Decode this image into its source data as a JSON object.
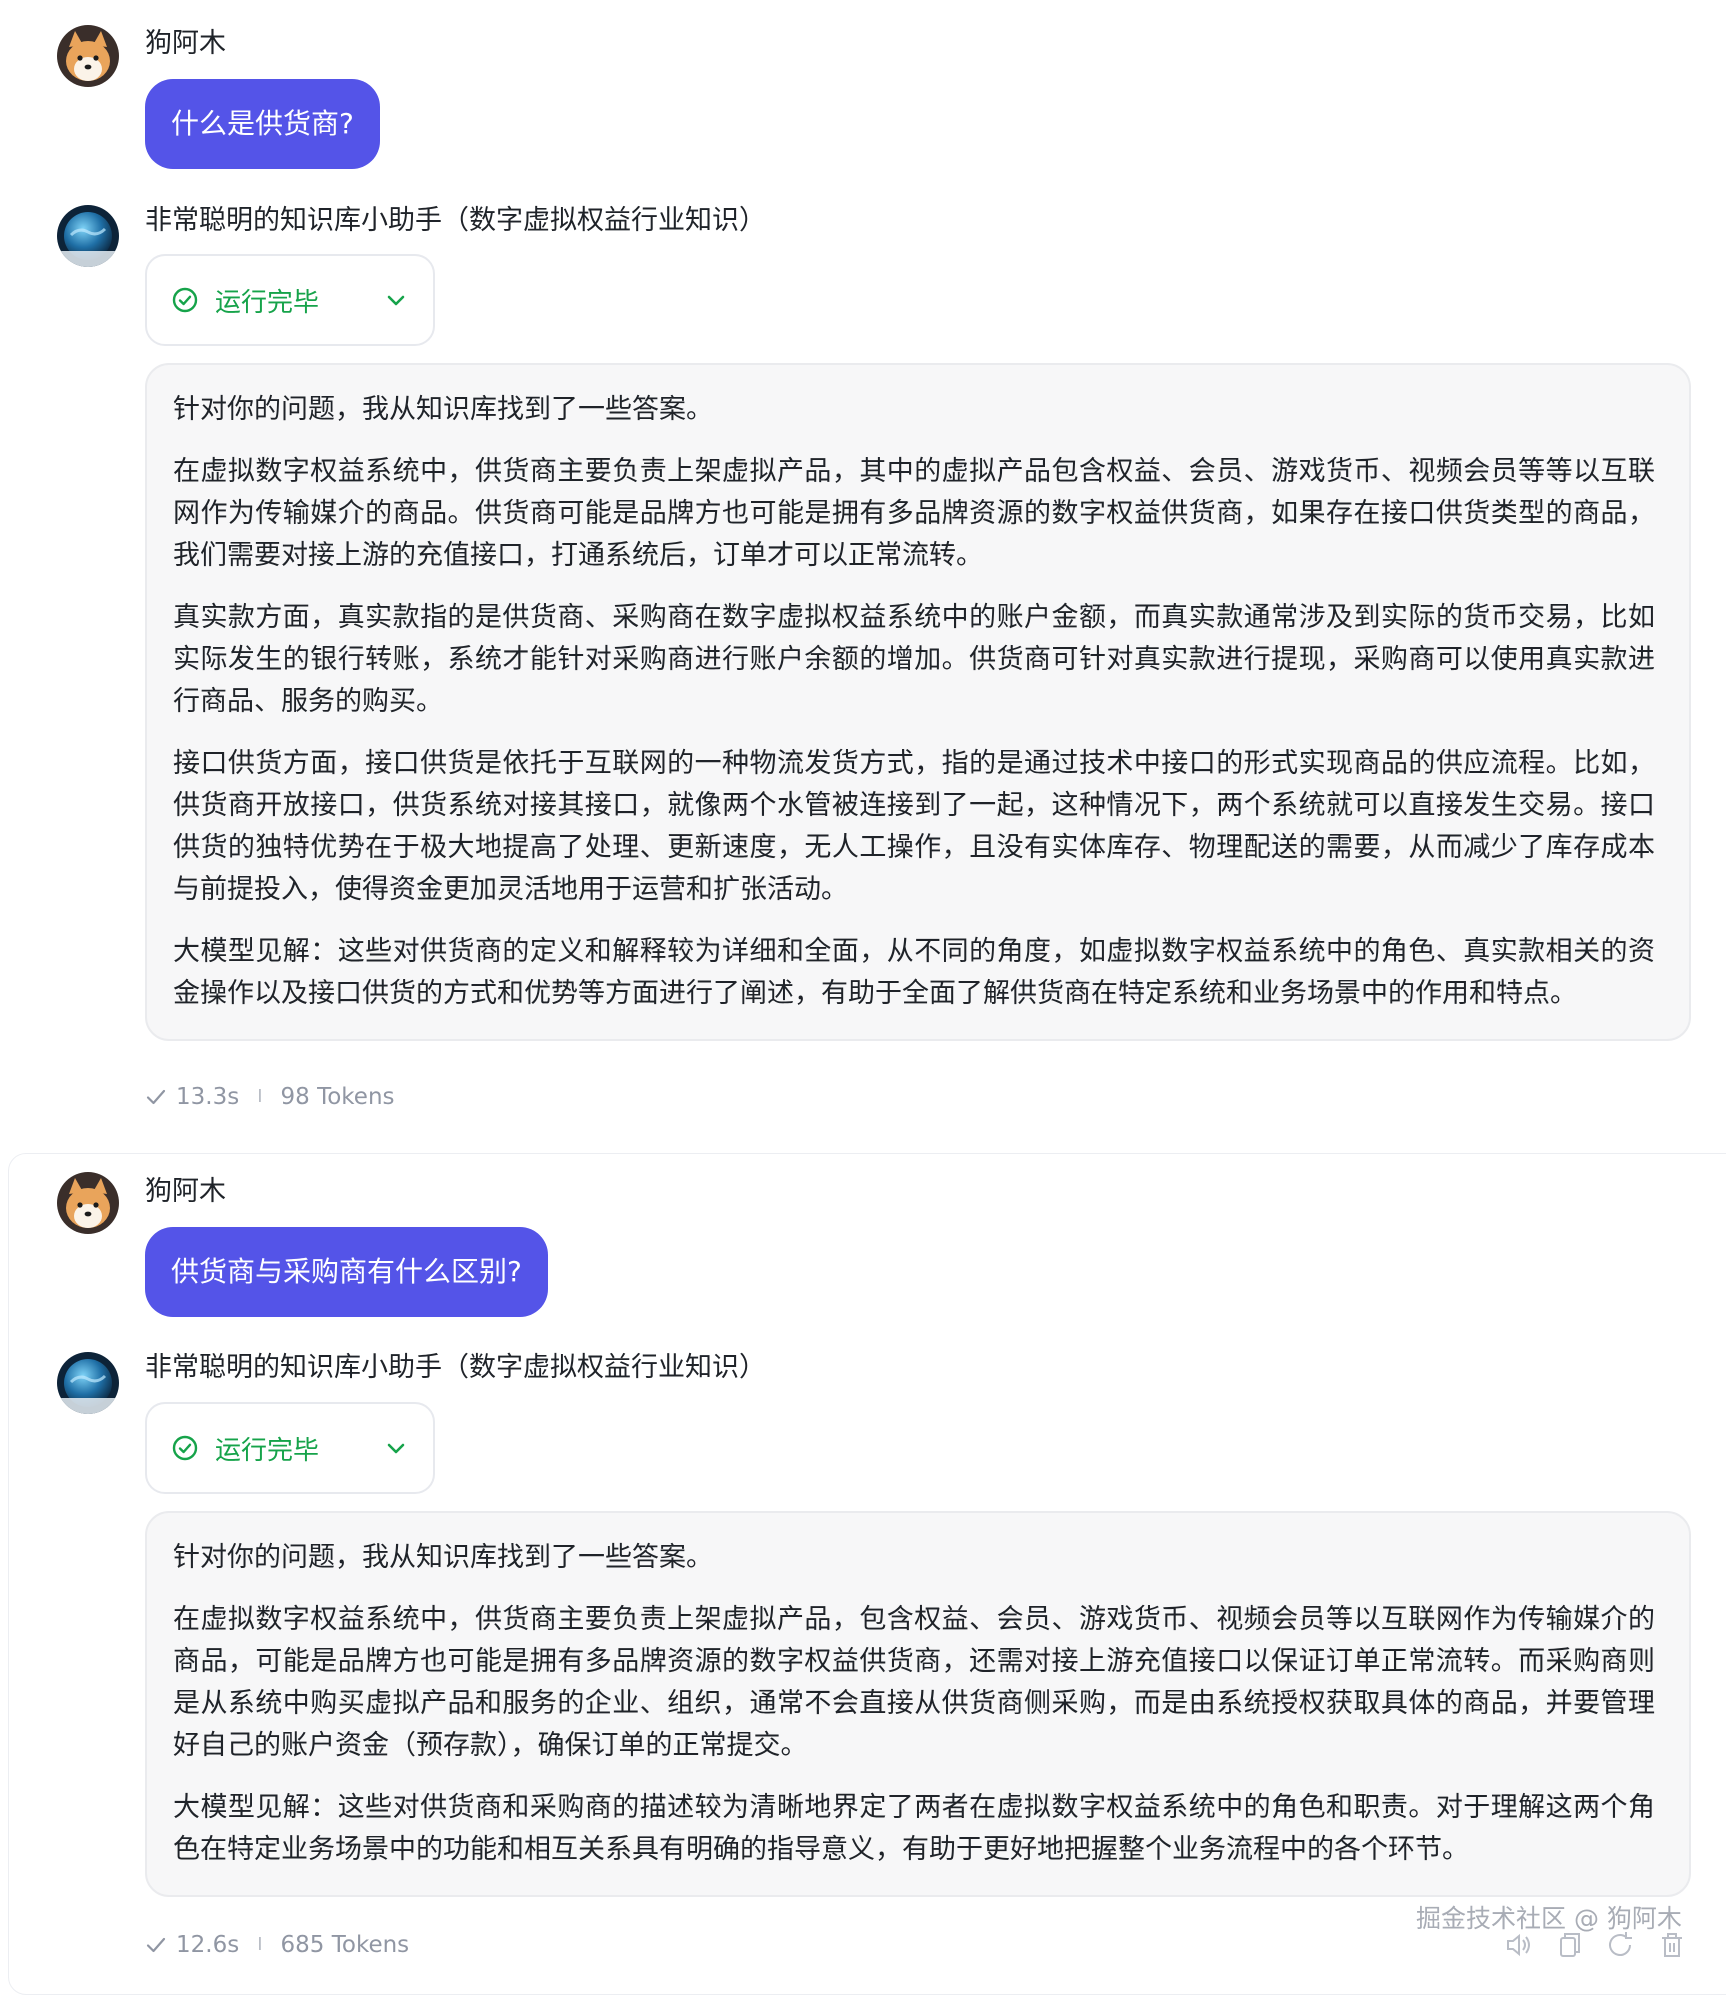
{
  "user": {
    "name": "狗阿木"
  },
  "bot": {
    "name": "非常聪明的知识库小助手（数字虚拟权益行业知识）"
  },
  "turns": [
    {
      "question": "什么是供货商?",
      "status": "运行完毕",
      "paragraphs": [
        "针对你的问题，我从知识库找到了一些答案。",
        "在虚拟数字权益系统中，供货商主要负责上架虚拟产品，其中的虚拟产品包含权益、会员、游戏货币、视频会员等等以互联网作为传输媒介的商品。供货商可能是品牌方也可能是拥有多品牌资源的数字权益供货商，如果存在接口供货类型的商品，我们需要对接上游的充值接口，打通系统后，订单才可以正常流转。",
        "真实款方面，真实款指的是供货商、采购商在数字虚拟权益系统中的账户金额，而真实款通常涉及到实际的货币交易，比如实际发生的银行转账，系统才能针对采购商进行账户余额的增加。供货商可针对真实款进行提现，采购商可以使用真实款进行商品、服务的购买。",
        "接口供货方面，接口供货是依托于互联网的一种物流发货方式，指的是通过技术中接口的形式实现商品的供应流程。比如，供货商开放接口，供货系统对接其接口，就像两个水管被连接到了一起，这种情况下，两个系统就可以直接发生交易。接口供货的独特优势在于极大地提高了处理、更新速度，无人工操作，且没有实体库存、物理配送的需要，从而减少了库存成本与前提投入，使得资金更加灵活地用于运营和扩张活动。",
        "大模型见解：这些对供货商的定义和解释较为详细和全面，从不同的角度，如虚拟数字权益系统中的角色、真实款相关的资金操作以及接口供货的方式和优势等方面进行了阐述，有助于全面了解供货商在特定系统和业务场景中的作用和特点。"
      ],
      "duration": "13.3s",
      "tokens": "98 Tokens"
    },
    {
      "question": "供货商与采购商有什么区别?",
      "status": "运行完毕",
      "paragraphs": [
        "针对你的问题，我从知识库找到了一些答案。",
        "在虚拟数字权益系统中，供货商主要负责上架虚拟产品，包含权益、会员、游戏货币、视频会员等以互联网作为传输媒介的商品，可能是品牌方也可能是拥有多品牌资源的数字权益供货商，还需对接上游充值接口以保证订单正常流转。而采购商则是从系统中购买虚拟产品和服务的企业、组织，通常不会直接从供货商侧采购，而是由系统授权获取具体的商品，并要管理好自己的账户资金（预存款），确保订单的正常提交。",
        "大模型见解：这些对供货商和采购商的描述较为清晰地界定了两者在虚拟数字权益系统中的角色和职责。对于理解这两个角色在特定业务场景中的功能和相互关系具有明确的指导意义，有助于更好地把握整个业务流程中的各个环节。"
      ],
      "duration": "12.6s",
      "tokens": "685 Tokens"
    }
  ],
  "watermark": "掘金技术社区 @ 狗阿木",
  "icons": {
    "status": "check-circle-icon",
    "expand": "chevron-down-icon",
    "meta": "checkmark-icon",
    "actions": [
      "speaker-icon",
      "copy-icon",
      "regenerate-icon",
      "delete-icon"
    ]
  },
  "colors": {
    "user_bubble": "#5454e8",
    "status_green": "#16a34a",
    "answer_bg": "#f7f7f8",
    "meta_text": "#9096a3"
  }
}
